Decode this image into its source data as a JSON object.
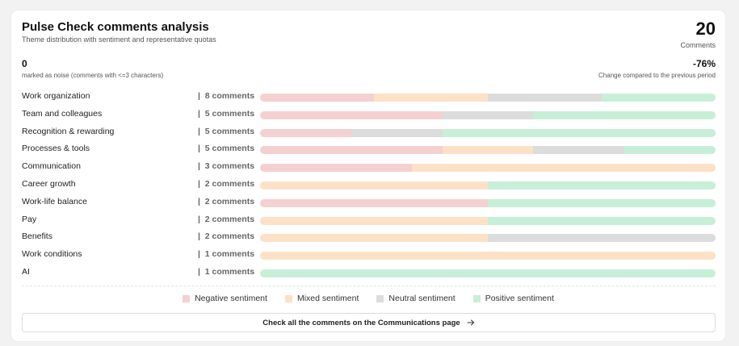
{
  "header": {
    "title": "Pulse Check comments analysis",
    "subtitle": "Theme distribution with sentiment and representative quotas",
    "total_count": "20",
    "total_label": "Comments"
  },
  "stats": {
    "noise_count": "0",
    "noise_label": "marked as noise (comments with <=3 characters)",
    "change_value": "-76%",
    "change_label": "Change compared to the previous period"
  },
  "colors": {
    "negative": "#f5d0d0",
    "mixed": "#fde1c6",
    "neutral": "#dcdcdc",
    "positive": "#c7efd7"
  },
  "themes": [
    {
      "label": "Work organization",
      "count": "|  8 comments",
      "sentiment": {
        "negative": 0.25,
        "mixed": 0.25,
        "neutral": 0.25,
        "positive": 0.25
      }
    },
    {
      "label": "Team and colleagues",
      "count": "|  5 comments",
      "sentiment": {
        "negative": 0.4,
        "mixed": 0,
        "neutral": 0.2,
        "positive": 0.4
      }
    },
    {
      "label": "Recognition & rewarding",
      "count": "|  5 comments",
      "sentiment": {
        "negative": 0.2,
        "mixed": 0,
        "neutral": 0.2,
        "positive": 0.6
      }
    },
    {
      "label": "Processes & tools",
      "count": "|  5 comments",
      "sentiment": {
        "negative": 0.4,
        "mixed": 0.2,
        "neutral": 0.2,
        "positive": 0.2
      }
    },
    {
      "label": "Communication",
      "count": "|  3 comments",
      "sentiment": {
        "negative": 0.333,
        "mixed": 0.667,
        "neutral": 0,
        "positive": 0
      }
    },
    {
      "label": "Career growth",
      "count": "|  2 comments",
      "sentiment": {
        "negative": 0,
        "mixed": 0.5,
        "neutral": 0,
        "positive": 0.5
      }
    },
    {
      "label": "Work-life balance",
      "count": "|  2 comments",
      "sentiment": {
        "negative": 0.5,
        "mixed": 0,
        "neutral": 0,
        "positive": 0.5
      }
    },
    {
      "label": "Pay",
      "count": "|  2 comments",
      "sentiment": {
        "negative": 0,
        "mixed": 0.5,
        "neutral": 0,
        "positive": 0.5
      }
    },
    {
      "label": "Benefits",
      "count": "|  2 comments",
      "sentiment": {
        "negative": 0,
        "mixed": 0.5,
        "neutral": 0.5,
        "positive": 0
      }
    },
    {
      "label": "Work conditions",
      "count": "|  1 comments",
      "sentiment": {
        "negative": 0,
        "mixed": 1,
        "neutral": 0,
        "positive": 0
      }
    },
    {
      "label": "AI",
      "count": "|  1 comments",
      "sentiment": {
        "negative": 0,
        "mixed": 0,
        "neutral": 0,
        "positive": 1
      }
    }
  ],
  "legend": {
    "negative": "Negative sentiment",
    "mixed": "Mixed sentiment",
    "neutral": "Neutral sentiment",
    "positive": "Positive sentiment"
  },
  "cta": {
    "label": "Check all the comments on the Communications page",
    "icon": "arrow-right-icon"
  }
}
